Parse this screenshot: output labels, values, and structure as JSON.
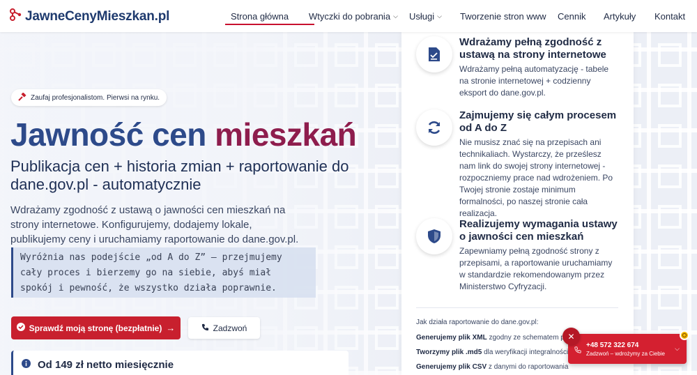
{
  "header": {
    "logo_text": "JawneCenyMieszkan.pl",
    "nav": [
      {
        "label": "Strona główna",
        "has_dropdown": false,
        "active": true
      },
      {
        "label": "Wtyczki do pobrania",
        "has_dropdown": true,
        "active": false
      },
      {
        "label": "Usługi",
        "has_dropdown": true,
        "active": false
      },
      {
        "label": "Tworzenie stron www",
        "has_dropdown": false,
        "active": false
      },
      {
        "label": "Cennik",
        "has_dropdown": false,
        "active": false
      },
      {
        "label": "Artykuły",
        "has_dropdown": false,
        "active": false
      },
      {
        "label": "Kontakt",
        "has_dropdown": false,
        "active": false
      }
    ]
  },
  "hero": {
    "badge": "Zaufaj profesjonalistom. Pierwsi na rynku.",
    "title_part1": "Jawność cen",
    "title_part2": "mieszkań",
    "subtitle": "Publikacja cen + historia zmian + raportowanie do dane.gov.pl - automatycznie",
    "description": "Wdrażamy zgodność z ustawą o jawności cen mieszkań na strony internetowe. Konfigurujemy, dodajemy lokale, publikujemy ceny i uruchamiamy raportowanie do dane.gov.pl.",
    "quote": "Wyróżnia nas podejście „od A do Z” — przejmujemy cały proces i bierzemy go na siebie, abyś miał spokój i pewność, że wszystko działa poprawnie.",
    "primary_button": "Sprawdź moją stronę (bezpłatnie)",
    "secondary_button": "Zadzwoń",
    "price": "Od 149 zł netto miesięcznie"
  },
  "features": [
    {
      "icon": "document-icon",
      "title": "Wdrażamy pełną zgodność z ustawą na strony internetowe",
      "text": "Wdrażamy pełną automatyzację - tabele na stronie internetowej + codzienny eksport do dane.gov.pl."
    },
    {
      "icon": "refresh-icon",
      "title": "Zajmujemy się całym procesem od A do Z",
      "text": "Nie musisz znać się na przepisach ani technikaliach. Wystarczy, że prześlesz nam link do swojej strony internetowej - rozpoczniemy prace nad wdrożeniem. Po Twojej stronie zostaje minimum formalności, po naszej stronie cała realizacja."
    },
    {
      "icon": "shield-icon",
      "title": "Realizujemy wymagania ustawy o jawności cen mieszkań",
      "text": "Zapewniamy pełną zgodność strony z przepisami, a raportowanie uruchamiamy w standardzie rekomendowanym przez Ministerstwo Cyfryzacji."
    }
  ],
  "howto": {
    "title": "Jak działa raportowanie do dane.gov.pl:",
    "lines": [
      {
        "bold": "Generujemy plik XML",
        "rest": " zgodny ze schematem portalu"
      },
      {
        "bold": "Tworzymy plik .md5",
        "rest": " dla weryfikacji integralności danych"
      },
      {
        "bold": "Generujemy plik CSV",
        "rest": " z danymi do raportowania"
      }
    ]
  },
  "call_widget": {
    "phone": "+48 572 322 674",
    "subtitle": "Zadzwoń – wdrożymy za Ciebie"
  },
  "colors": {
    "brand_blue": "#2d4a8a",
    "brand_red": "#c8202e",
    "brand_purple": "#8e1d4d"
  }
}
